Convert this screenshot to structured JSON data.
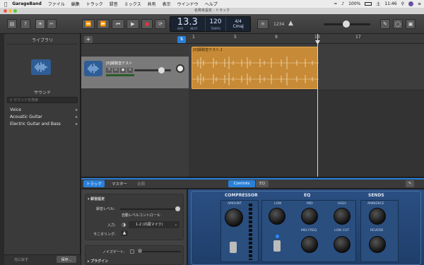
{
  "menubar": {
    "app": "GarageBand",
    "items": [
      "ファイル",
      "編集",
      "トラック",
      "録音",
      "ミックス",
      "共有",
      "表示",
      "ウインドウ",
      "ヘルプ"
    ],
    "battery": "100%",
    "day": "土",
    "time": "11:46"
  },
  "window": {
    "title": "名称未設定 - トラック"
  },
  "lcd": {
    "position": "13.3",
    "position_sub": "BAR",
    "beat_sub": "BEAT",
    "tempo": "120",
    "tempo_sub": "TEMPO",
    "signature": "4/4",
    "key": "Cmaj"
  },
  "toolbar": {
    "count_in": "1234"
  },
  "library": {
    "title": "ライブラリ",
    "sounds_title": "サウンド",
    "search_placeholder": "サウンドを検索",
    "categories": [
      "Voice",
      "Acoustic Guitar",
      "Electric Guitar and Bass"
    ],
    "revert_label": "元に戻す",
    "save_label": "保存..."
  },
  "tracks": {
    "add_label": "+",
    "track_name": "[6]録製音テスト",
    "region_name": "[6]録製音テスト.1",
    "ruler": [
      "1",
      "5",
      "9",
      "13",
      "17"
    ]
  },
  "editor": {
    "tabs": [
      "トラック",
      "マスター",
      "比較"
    ],
    "plugin_tabs": [
      "Controls",
      "EQ"
    ],
    "section_title": "録音設定",
    "level_label": "録音レベル:",
    "auto_level_label": "自動レベルコントロール",
    "input_label": "入力:",
    "input_value": "1-2 (内蔵マイク)",
    "monitoring_label": "モニタリング:",
    "noise_gate_label": "ノイズゲート:",
    "plugins_label": "プラグイン"
  },
  "plugin": {
    "compressor": "COMPRESSOR",
    "eq": "EQ",
    "sends": "SENDS",
    "amount": "AMOUNT",
    "low": "LOW",
    "mid": "MID",
    "high": "HIGH",
    "mid_freq": "MID FREQ",
    "low_cut": "LOW CUT",
    "ambience": "AMBIENCE",
    "reverb": "REVERB"
  }
}
